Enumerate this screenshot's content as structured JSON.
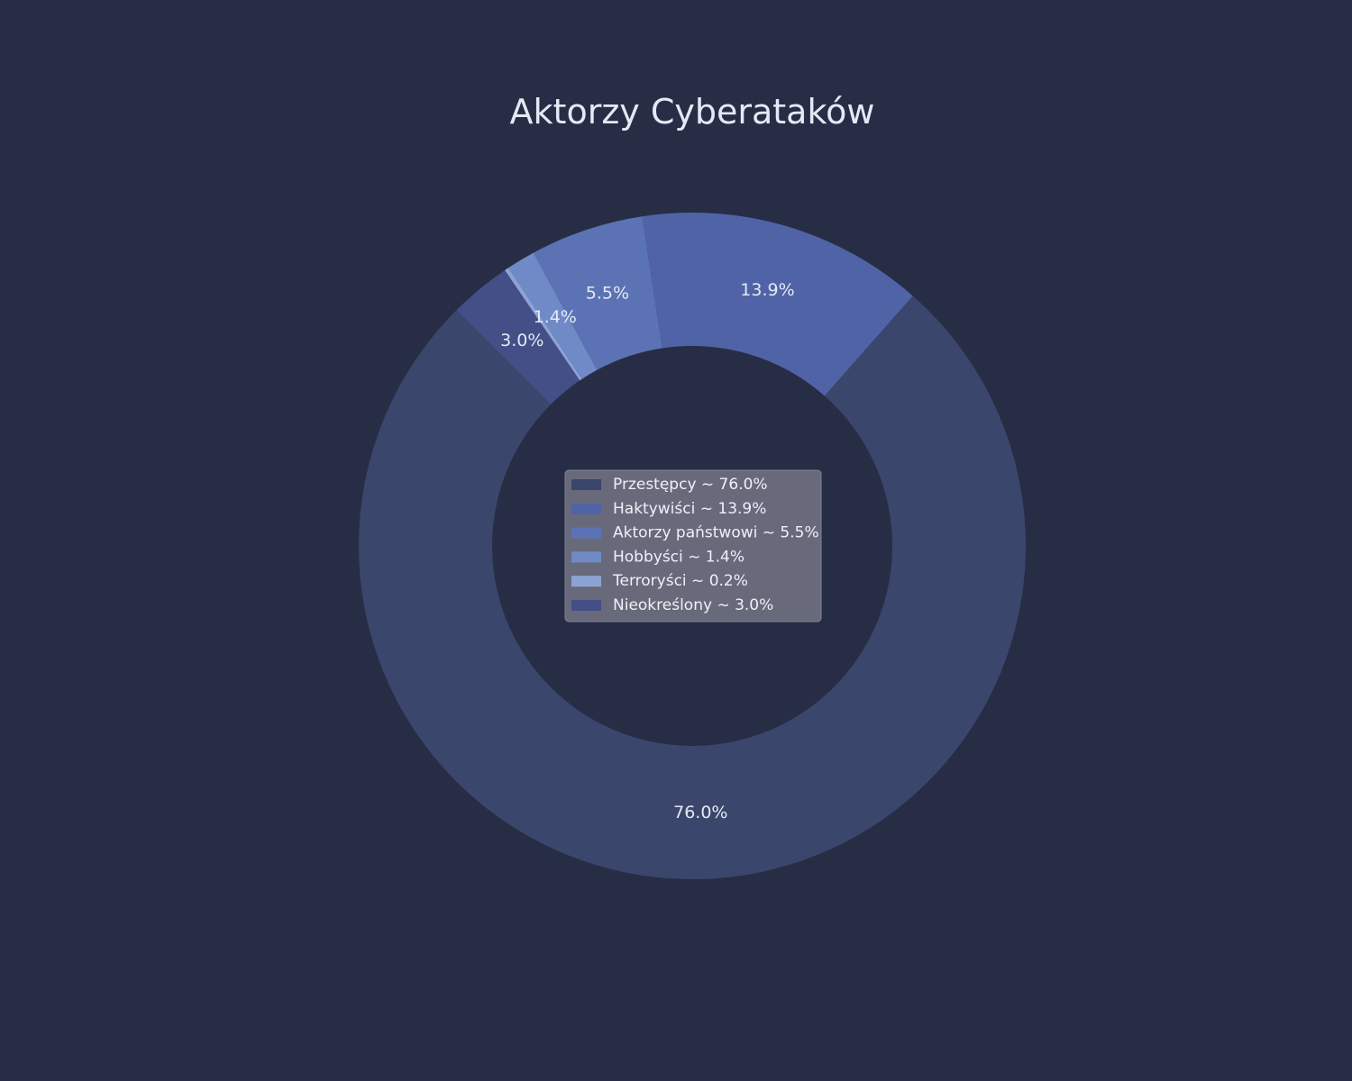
{
  "chart_data": {
    "type": "pie",
    "variant": "donut",
    "title": "Aktorzy Cyberataków",
    "categories": [
      "Przestępcy",
      "Haktywiści",
      "Aktorzy państwowi",
      "Hobbyści",
      "Terroryści",
      "Nieokreślony"
    ],
    "values": [
      76.0,
      13.9,
      5.5,
      1.4,
      0.2,
      3.0
    ],
    "slice_labels": [
      "76.0%",
      "13.9%",
      "5.5%",
      "1.4%",
      "",
      "3.0%"
    ],
    "legend_entries": [
      "Przestępcy ~ 76.0%",
      "Haktywiści ~ 13.9%",
      "Aktorzy państwowi ~ 5.5%",
      "Hobbyści ~ 1.4%",
      "Terroryści ~ 0.2%",
      "Nieokreślony ~ 3.0%"
    ],
    "colors": [
      "#3a466b",
      "#5063a6",
      "#5b73b4",
      "#6f8ac6",
      "#8ca4d4",
      "#434f86"
    ],
    "legend_position": "center",
    "start_angle_deg": 135,
    "direction": "counterclockwise"
  },
  "colors": {
    "background": "#282d46",
    "title_text": "#e6e9f5",
    "legend_background": "#6b6e7e"
  }
}
